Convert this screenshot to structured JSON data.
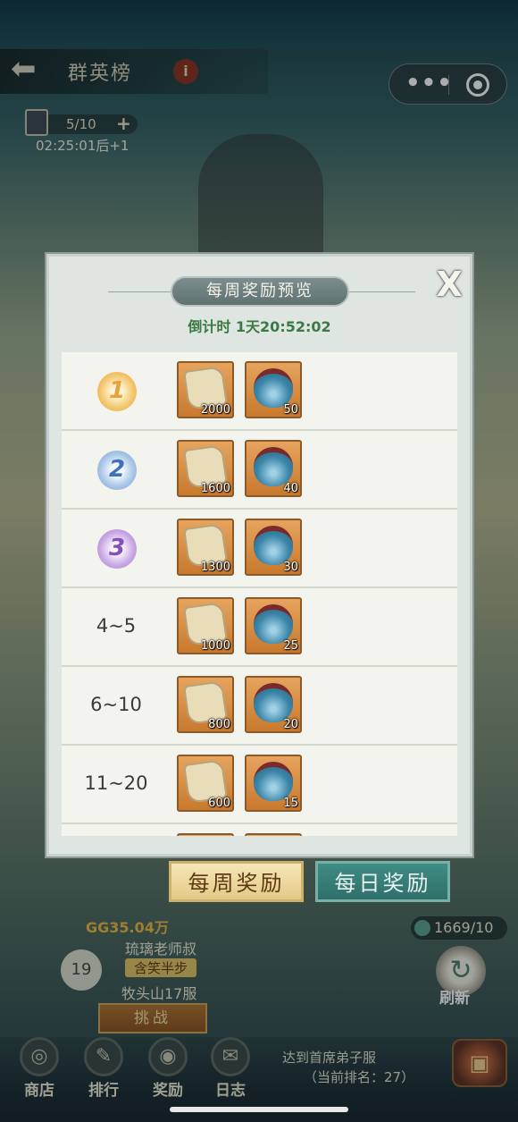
{
  "header": {
    "title": "群英榜",
    "info": "i"
  },
  "capsule": {
    "more": "•••"
  },
  "ticket": {
    "count": "5/10",
    "plus": "+",
    "timer": "02:25:01后+1"
  },
  "modal": {
    "title": "每周奖励预览",
    "close": "X",
    "countdown": "倒计时 1天20:52:02",
    "rows": [
      {
        "rank": "1",
        "scroll_qty": "2000",
        "bag_qty": "50"
      },
      {
        "rank": "2",
        "scroll_qty": "1600",
        "bag_qty": "40"
      },
      {
        "rank": "3",
        "scroll_qty": "1300",
        "bag_qty": "30"
      },
      {
        "rank": "4~5",
        "scroll_qty": "1000",
        "bag_qty": "25"
      },
      {
        "rank": "6~10",
        "scroll_qty": "800",
        "bag_qty": "20"
      },
      {
        "rank": "11~20",
        "scroll_qty": "600",
        "bag_qty": "15"
      }
    ]
  },
  "tabs": {
    "weekly": "每周奖励",
    "daily": "每日奖励"
  },
  "player": {
    "power": "GG35.04万",
    "name": "琉璃老师叔",
    "tag": "含笑半步",
    "server": "牧头山17服",
    "rank": "19",
    "challenge": "挑战"
  },
  "resources": {
    "jade": "1669/10",
    "refresh": "刷新",
    "refresh_icon": "↻"
  },
  "nav": [
    {
      "label": "商店",
      "icon": "shop-icon"
    },
    {
      "label": "排行",
      "icon": "ranking-icon"
    },
    {
      "label": "奖励",
      "icon": "reward-icon"
    },
    {
      "label": "日志",
      "icon": "log-icon"
    }
  ],
  "footer": {
    "line1": "达到首席弟子服",
    "line2": "（当前排名：27）"
  }
}
